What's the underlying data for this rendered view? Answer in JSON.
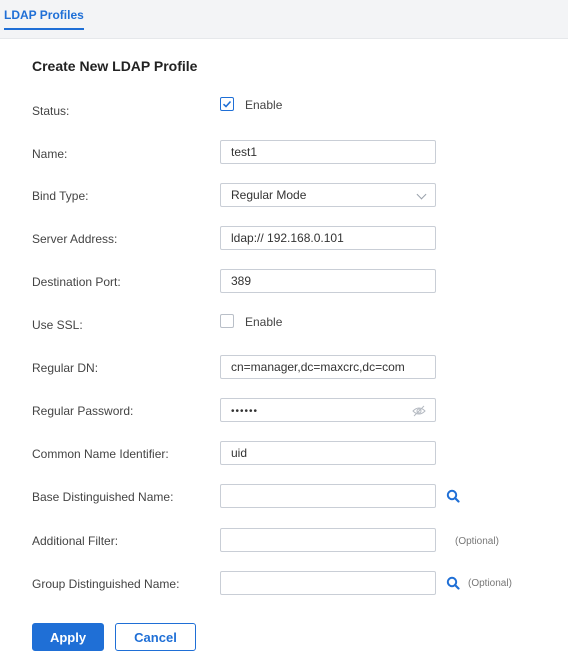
{
  "tabs": {
    "active": "LDAP Profiles"
  },
  "form": {
    "title": "Create New LDAP Profile",
    "status": {
      "label": "Status:",
      "checkbox_label": "Enable",
      "checked": true
    },
    "name": {
      "label": "Name:",
      "value": "test1"
    },
    "bind_type": {
      "label": "Bind Type:",
      "value": "Regular Mode"
    },
    "server_address": {
      "label": "Server Address:",
      "value": "ldap:// 192.168.0.101"
    },
    "destination_port": {
      "label": "Destination Port:",
      "value": "389"
    },
    "use_ssl": {
      "label": "Use SSL:",
      "checkbox_label": "Enable",
      "checked": false
    },
    "regular_dn": {
      "label": "Regular DN:",
      "value": "cn=manager,dc=maxcrc,dc=com"
    },
    "regular_password": {
      "label": "Regular Password:",
      "value": "••••••"
    },
    "common_name_identifier": {
      "label": "Common Name Identifier:",
      "value": "uid"
    },
    "base_dn": {
      "label": "Base Distinguished Name:",
      "value": ""
    },
    "additional_filter": {
      "label": "Additional Filter:",
      "value": "",
      "hint": "(Optional)"
    },
    "group_dn": {
      "label": "Group Distinguished Name:",
      "value": "",
      "hint": "(Optional)"
    }
  },
  "buttons": {
    "apply": "Apply",
    "cancel": "Cancel"
  },
  "colors": {
    "accent": "#1f6fd6"
  },
  "icons": [
    "check-icon",
    "chevron-down-icon",
    "eye-slash-icon",
    "search-icon"
  ]
}
